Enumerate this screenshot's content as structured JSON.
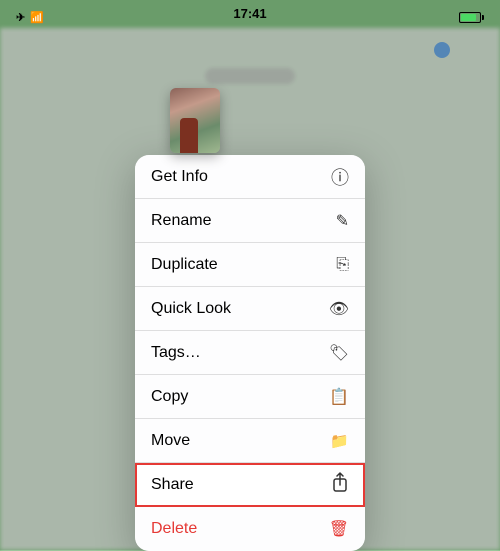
{
  "statusBar": {
    "time": "17:41",
    "signal": "signal",
    "wifi": "wifi",
    "battery": "battery"
  },
  "menu": {
    "items": [
      {
        "id": "get-info",
        "label": "Get Info",
        "icon": "ℹ",
        "highlighted": false,
        "delete": false
      },
      {
        "id": "rename",
        "label": "Rename",
        "icon": "✏",
        "highlighted": false,
        "delete": false
      },
      {
        "id": "duplicate",
        "label": "Duplicate",
        "icon": "⧉",
        "highlighted": false,
        "delete": false
      },
      {
        "id": "quick-look",
        "label": "Quick Look",
        "icon": "👁",
        "highlighted": false,
        "delete": false
      },
      {
        "id": "tags",
        "label": "Tags…",
        "icon": "🏷",
        "highlighted": false,
        "delete": false
      },
      {
        "id": "copy",
        "label": "Copy",
        "icon": "📋",
        "highlighted": false,
        "delete": false
      },
      {
        "id": "move",
        "label": "Move",
        "icon": "📁",
        "highlighted": false,
        "delete": false
      },
      {
        "id": "share",
        "label": "Share",
        "icon": "↑",
        "highlighted": true,
        "delete": false
      },
      {
        "id": "delete",
        "label": "Delete",
        "icon": "🗑",
        "highlighted": false,
        "delete": true
      }
    ]
  }
}
